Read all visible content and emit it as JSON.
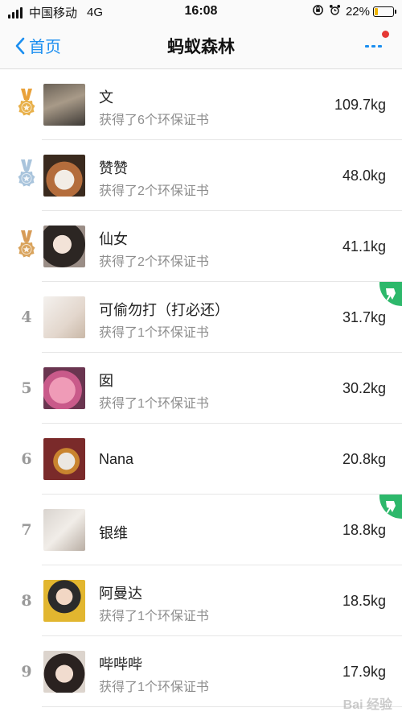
{
  "status_bar": {
    "carrier": "中国移动",
    "network": "4G",
    "time": "16:08",
    "battery_percent": "22%",
    "battery_level": 0.22,
    "icons": [
      "signal-icon",
      "rotation-lock-icon",
      "alarm-icon",
      "battery-icon"
    ]
  },
  "nav": {
    "back_label": "首页",
    "title": "蚂蚁森林",
    "more_icon": "more-icon",
    "has_notification_dot": true
  },
  "colors": {
    "accent": "#1a8ef0",
    "gold_medal": "#e8b04a",
    "silver_medal": "#a9c4dc",
    "bronze_medal": "#d9a35c",
    "steal_badge": "#2db86b",
    "notification_dot": "#e53935",
    "battery_fill": "#f0b400"
  },
  "ranking": [
    {
      "rank": "1",
      "medal": "gold",
      "name": "文",
      "subtitle": "获得了6个环保证书",
      "weight": "109.7kg",
      "steal": false
    },
    {
      "rank": "2",
      "medal": "silver",
      "name": "赞赞",
      "subtitle": "获得了2个环保证书",
      "weight": "48.0kg",
      "steal": false
    },
    {
      "rank": "3",
      "medal": "bronze",
      "name": "仙女",
      "subtitle": "获得了2个环保证书",
      "weight": "41.1kg",
      "steal": false
    },
    {
      "rank": "4",
      "medal": null,
      "name": "可偷勿打（打必还）",
      "subtitle": "获得了1个环保证书",
      "weight": "31.7kg",
      "steal": true
    },
    {
      "rank": "5",
      "medal": null,
      "name": "囡",
      "subtitle": "获得了1个环保证书",
      "weight": "30.2kg",
      "steal": false
    },
    {
      "rank": "6",
      "medal": null,
      "name": "Nana",
      "subtitle": "",
      "weight": "20.8kg",
      "steal": false
    },
    {
      "rank": "7",
      "medal": null,
      "name": "银维",
      "subtitle": "",
      "weight": "18.8kg",
      "steal": true
    },
    {
      "rank": "8",
      "medal": null,
      "name": "阿曼达",
      "subtitle": "获得了1个环保证书",
      "weight": "18.5kg",
      "steal": false
    },
    {
      "rank": "9",
      "medal": null,
      "name": "哔哔哔",
      "subtitle": "获得了1个环保证书",
      "weight": "17.9kg",
      "steal": false
    }
  ],
  "watermark": "Bai 经验"
}
